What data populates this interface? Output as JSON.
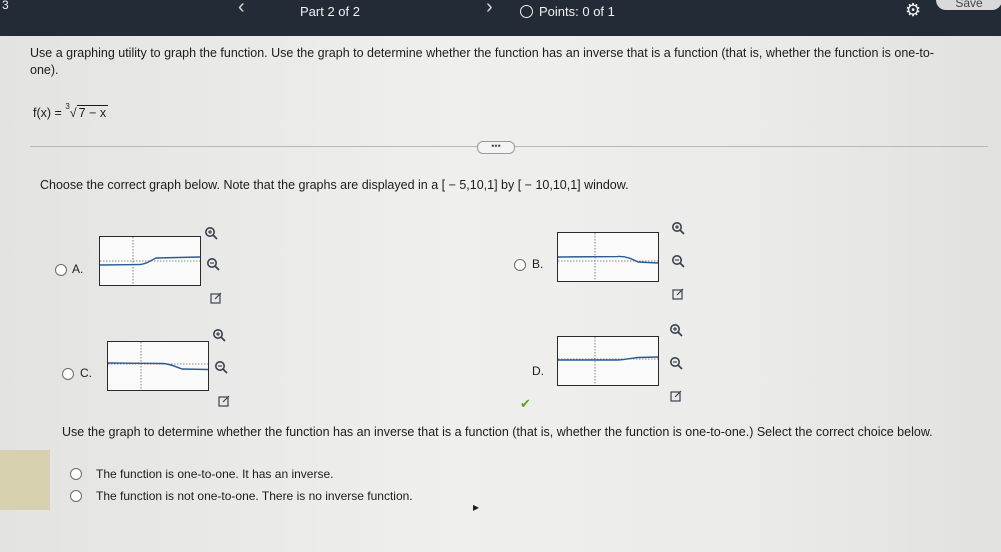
{
  "header": {
    "left_number": "3",
    "part": "Part 2 of 2",
    "prev": "‹",
    "next": "›",
    "points": "Points: 0 of 1",
    "save": "Save"
  },
  "question": {
    "instruction": "Use a graphing utility to graph the function. Use the graph to determine whether the function has an inverse that is a function (that is, whether the function is one-to-one).",
    "function_lhs": "f(x) =",
    "root_index": "3",
    "radicand": "7 − x",
    "more": "•••",
    "choose_prompt": "Choose the correct graph below. Note that the graphs are displayed in a [ − 5,10,1] by [ − 10,10,1] window."
  },
  "graph_options": [
    {
      "letter": "A."
    },
    {
      "letter": "B."
    },
    {
      "letter": "C."
    },
    {
      "letter": "D."
    }
  ],
  "part2": {
    "prompt": "Use the graph to determine whether the function has an inverse that is a function (that is, whether the function is one-to-one.) Select the correct choice below.",
    "choices": [
      "The function is one-to-one. It has an inverse.",
      "The function is not one-to-one. There is no inverse function."
    ]
  }
}
